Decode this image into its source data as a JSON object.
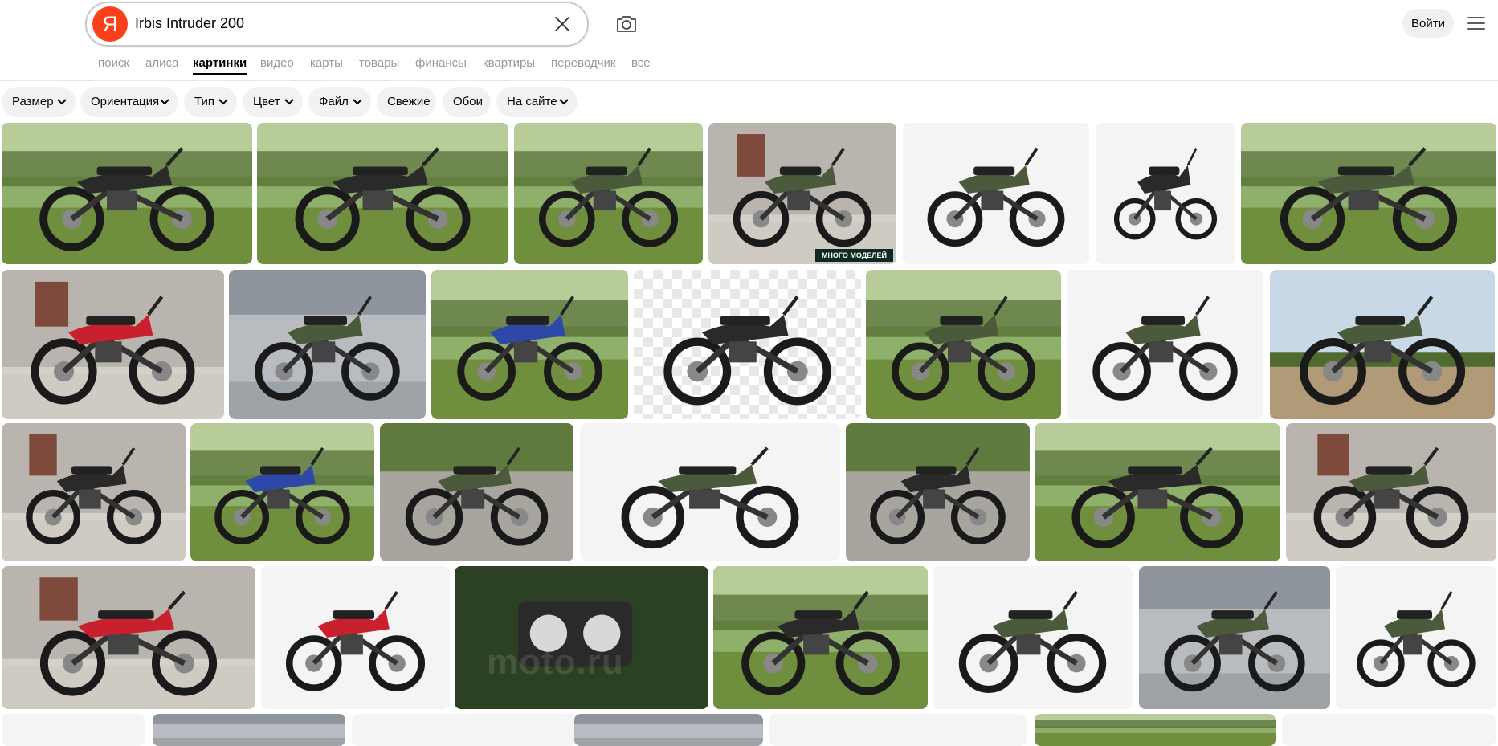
{
  "search": {
    "query": "Irbis Intruder 200",
    "placeholder": ""
  },
  "logo": {
    "letter": "Я",
    "color": "#fc3f1d"
  },
  "header": {
    "login_label": "Войти"
  },
  "tabs": [
    {
      "label": "поиск",
      "active": false
    },
    {
      "label": "алиса",
      "active": false
    },
    {
      "label": "картинки",
      "active": true
    },
    {
      "label": "видео",
      "active": false
    },
    {
      "label": "карты",
      "active": false
    },
    {
      "label": "товары",
      "active": false
    },
    {
      "label": "финансы",
      "active": false
    },
    {
      "label": "квартиры",
      "active": false
    },
    {
      "label": "переводчик",
      "active": false
    },
    {
      "label": "все",
      "active": false
    }
  ],
  "filters": [
    {
      "label": "Размер",
      "dropdown": true
    },
    {
      "label": "Ориентация",
      "dropdown": true
    },
    {
      "label": "Тип",
      "dropdown": true
    },
    {
      "label": "Цвет",
      "dropdown": true
    },
    {
      "label": "Файл",
      "dropdown": true
    },
    {
      "label": "Свежие",
      "dropdown": false
    },
    {
      "label": "Обои",
      "dropdown": false
    },
    {
      "label": "На сайте",
      "dropdown": true
    }
  ],
  "images": {
    "badge_label": "МНОГО МОДЕЛЕЙ",
    "watermark_text": "moto.ru"
  },
  "icons": {
    "clear": "close-icon",
    "camera": "camera-icon",
    "menu": "hamburger-menu-icon",
    "chevron": "chevron-down-icon"
  },
  "colors": {
    "accent": "#fc3f1d",
    "chip_bg": "#f2f2f2",
    "bike_green": "#4a5a3a",
    "bike_black": "#2a2a2a",
    "bike_red": "#c8202c",
    "bike_blue": "#2d48a8",
    "grass": "#6f8f3e",
    "sky": "#c9d8e6"
  }
}
